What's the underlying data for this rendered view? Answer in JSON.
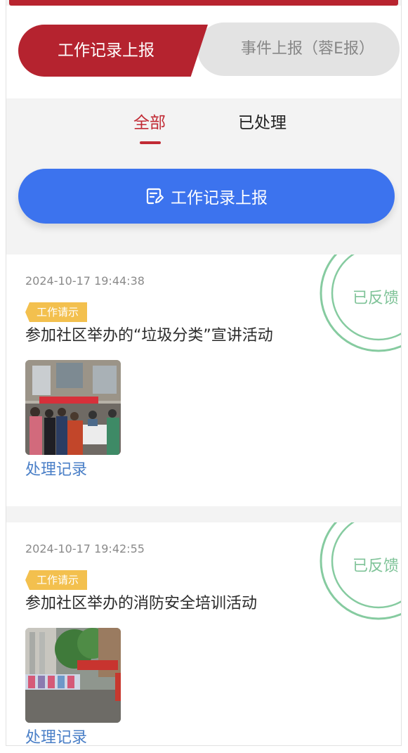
{
  "segments": {
    "work_record_report": "工作记录上报",
    "event_report": "事件上报（蓉E报）"
  },
  "filter_tabs": {
    "all": "全部",
    "processed": "已处理"
  },
  "report_button": {
    "label": "工作记录上报",
    "icon": "edit-note-icon"
  },
  "colors": {
    "brand_red": "#b5232f",
    "action_blue": "#3c73ee",
    "stamp_green": "#7fc398",
    "tag_yellow": "#f3c04e",
    "link_blue": "#4a7fc7"
  },
  "records": [
    {
      "time": "2024-10-17 19:44:38",
      "tag": "工作请示",
      "title": "参加社区举办的“垃圾分类”宣讲活动",
      "status": "已反馈",
      "link": "处理记录"
    },
    {
      "time": "2024-10-17 19:42:55",
      "tag": "工作请示",
      "title": "参加社区举办的消防安全培训活动",
      "status": "已反馈",
      "link": "处理记录"
    }
  ]
}
